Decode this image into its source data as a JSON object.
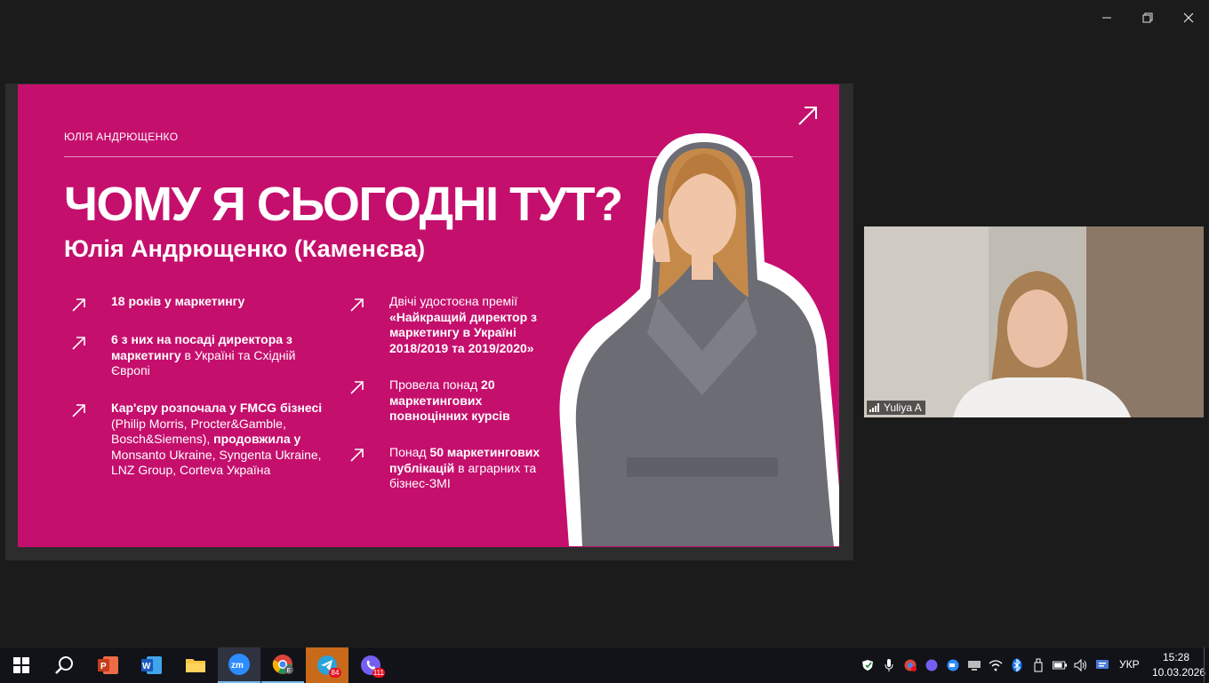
{
  "slide": {
    "author": "ЮЛІЯ АНДРЮЩЕНКО",
    "title": "ЧОМУ Я СЬОГОДНІ ТУТ?",
    "subtitle": "Юлія Андрющенко (Каменєва)",
    "left": [
      {
        "bold1": "18 років у маркетингу"
      },
      {
        "bold1": "6 з них на посаді директора з маркетингу",
        "normal1": " в Україні та Східній Європі"
      },
      {
        "bold1": "Кар'єру розпочала у FMCG бізнесі",
        "normal1": " (Philip Morris, Procter&Gamble, Bosch&Siemens),",
        "bold2": " продовжила у",
        "normal2": " Monsanto Ukraine, Syngenta Ukraine, LNZ Group, Corteva Україна"
      }
    ],
    "right": [
      {
        "normal1": "Двічі удостоєна премії ",
        "bold1": "«Найкращий директор з маркетингу в Україні 2018/2019 та 2019/2020»"
      },
      {
        "normal1": "Провела понад ",
        "bold1": "20 маркетингових повноцінних курсів"
      },
      {
        "normal1": "Понад ",
        "bold1": "50 маркетингових публікацій",
        "normal2": " в аграрних та бізнес-ЗМІ"
      }
    ],
    "colors": {
      "background": "#c50f6d",
      "text": "#ffffff"
    }
  },
  "video": {
    "participant_name": "Yuliya A"
  },
  "window_controls": {
    "minimize": "minimize-icon",
    "restore": "restore-icon",
    "close": "close-icon"
  },
  "taskbar": {
    "apps": [
      {
        "name": "start-icon"
      },
      {
        "name": "search-icon"
      },
      {
        "name": "powerpoint-icon"
      },
      {
        "name": "word-icon"
      },
      {
        "name": "file-explorer-icon"
      },
      {
        "name": "zoom-icon",
        "label": "zm"
      },
      {
        "name": "chrome-icon",
        "label": "E"
      },
      {
        "name": "telegram-icon",
        "badge": "84"
      },
      {
        "name": "viber-icon",
        "badge": "111"
      }
    ],
    "language": "УКР",
    "time": "15:28",
    "date": "10.03.2026"
  }
}
